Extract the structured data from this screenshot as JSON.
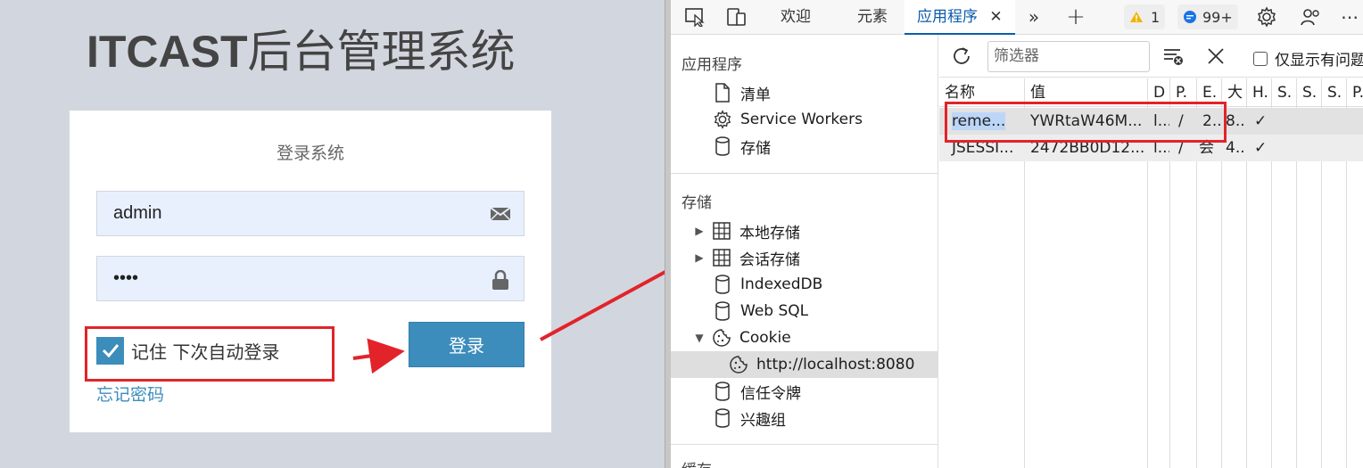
{
  "login": {
    "title_latin": "ITCAST",
    "title_cn": "后台管理系统",
    "box_title": "登录系统",
    "username_value": "admin",
    "password_value": "••••",
    "remember_label": "记住 下次自动登录",
    "login_button": "登录",
    "forgot_link": "忘记密码"
  },
  "devtools": {
    "tabs": [
      {
        "label": "欢迎"
      },
      {
        "label": "元素"
      },
      {
        "label": "应用程序",
        "active": true
      }
    ],
    "warnings_count": "1",
    "messages_count": "99+",
    "sidebar": {
      "app_section": "应用程序",
      "app_items": [
        "清单",
        "Service Workers",
        "存储"
      ],
      "storage_section": "存储",
      "storage_items": [
        "本地存储",
        "会话存储",
        "IndexedDB",
        "Web SQL",
        "Cookie"
      ],
      "cookie_origin": "http://localhost:8080",
      "other_items": [
        "信任令牌",
        "兴趣组"
      ],
      "cache_section": "缓存"
    },
    "filter_placeholder": "筛选器",
    "only_issues_label": "仅显示有问题",
    "table": {
      "headers": [
        "名称",
        "值",
        "D",
        "P.",
        "E.",
        "大",
        "H.",
        "S.",
        "S.",
        "S.",
        "P."
      ],
      "rows": [
        [
          "reme...",
          "YWRtaW46M...",
          "l...",
          "/",
          "2...",
          "8...",
          "✓",
          "",
          "",
          "",
          ""
        ],
        [
          "JSESSI...",
          "2472BB0D12...",
          "l...",
          "/",
          "会",
          "4...",
          "✓",
          "",
          "",
          "",
          ""
        ]
      ]
    }
  },
  "colors": {
    "accent": "#3c8dbc",
    "annotation_red": "#e2232a",
    "devtools_active": "#0b5cad"
  }
}
